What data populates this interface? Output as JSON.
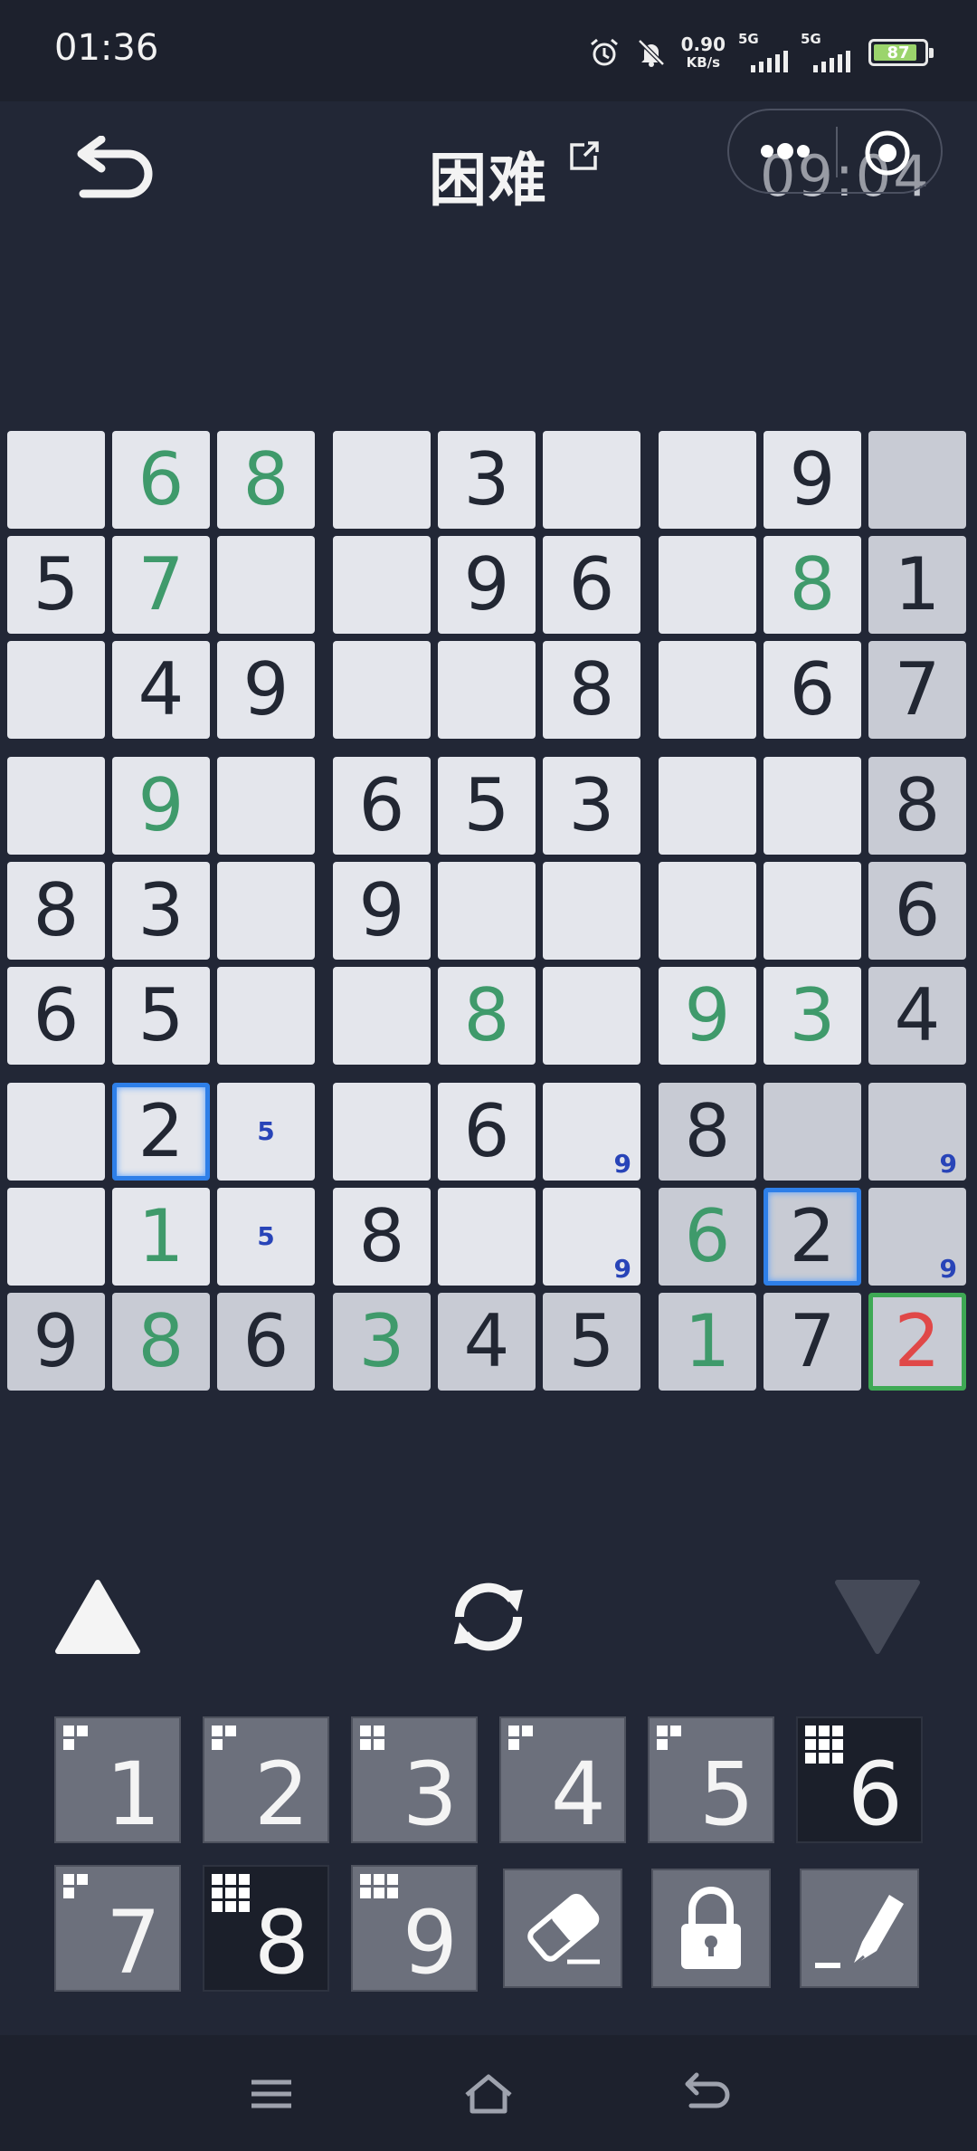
{
  "status_bar": {
    "time": "01:36",
    "net_speed_value": "0.90",
    "net_speed_unit": "KB/s",
    "sim1_label": "5G",
    "sim2_label": "5G",
    "battery_percent": "87",
    "icons": [
      "alarm-icon",
      "bell-muted-icon",
      "signal-icon",
      "battery-icon"
    ]
  },
  "header": {
    "title": "困难",
    "timer": "09:04",
    "icons": [
      "back-arrow-icon",
      "share-external-icon",
      "more-dots-icon",
      "close-target-icon"
    ]
  },
  "board": {
    "cells": [
      {
        "r": 0,
        "c": 0,
        "v": "",
        "t": "empty"
      },
      {
        "r": 0,
        "c": 1,
        "v": "6",
        "t": "user"
      },
      {
        "r": 0,
        "c": 2,
        "v": "8",
        "t": "user"
      },
      {
        "r": 0,
        "c": 3,
        "v": "",
        "t": "empty"
      },
      {
        "r": 0,
        "c": 4,
        "v": "3",
        "t": "given"
      },
      {
        "r": 0,
        "c": 5,
        "v": "",
        "t": "empty"
      },
      {
        "r": 0,
        "c": 6,
        "v": "",
        "t": "empty"
      },
      {
        "r": 0,
        "c": 7,
        "v": "9",
        "t": "given"
      },
      {
        "r": 0,
        "c": 8,
        "v": "",
        "t": "empty",
        "hl": true
      },
      {
        "r": 1,
        "c": 0,
        "v": "5",
        "t": "given"
      },
      {
        "r": 1,
        "c": 1,
        "v": "7",
        "t": "user"
      },
      {
        "r": 1,
        "c": 2,
        "v": "",
        "t": "empty"
      },
      {
        "r": 1,
        "c": 3,
        "v": "",
        "t": "empty"
      },
      {
        "r": 1,
        "c": 4,
        "v": "9",
        "t": "given"
      },
      {
        "r": 1,
        "c": 5,
        "v": "6",
        "t": "given"
      },
      {
        "r": 1,
        "c": 6,
        "v": "",
        "t": "empty"
      },
      {
        "r": 1,
        "c": 7,
        "v": "8",
        "t": "user"
      },
      {
        "r": 1,
        "c": 8,
        "v": "1",
        "t": "given",
        "hl": true
      },
      {
        "r": 2,
        "c": 0,
        "v": "",
        "t": "empty"
      },
      {
        "r": 2,
        "c": 1,
        "v": "4",
        "t": "given"
      },
      {
        "r": 2,
        "c": 2,
        "v": "9",
        "t": "given"
      },
      {
        "r": 2,
        "c": 3,
        "v": "",
        "t": "empty"
      },
      {
        "r": 2,
        "c": 4,
        "v": "",
        "t": "empty"
      },
      {
        "r": 2,
        "c": 5,
        "v": "8",
        "t": "given"
      },
      {
        "r": 2,
        "c": 6,
        "v": "",
        "t": "empty"
      },
      {
        "r": 2,
        "c": 7,
        "v": "6",
        "t": "given"
      },
      {
        "r": 2,
        "c": 8,
        "v": "7",
        "t": "given",
        "hl": true
      },
      {
        "r": 3,
        "c": 0,
        "v": "",
        "t": "empty"
      },
      {
        "r": 3,
        "c": 1,
        "v": "9",
        "t": "user"
      },
      {
        "r": 3,
        "c": 2,
        "v": "",
        "t": "empty"
      },
      {
        "r": 3,
        "c": 3,
        "v": "6",
        "t": "given"
      },
      {
        "r": 3,
        "c": 4,
        "v": "5",
        "t": "given"
      },
      {
        "r": 3,
        "c": 5,
        "v": "3",
        "t": "given"
      },
      {
        "r": 3,
        "c": 6,
        "v": "",
        "t": "empty"
      },
      {
        "r": 3,
        "c": 7,
        "v": "",
        "t": "empty"
      },
      {
        "r": 3,
        "c": 8,
        "v": "8",
        "t": "given",
        "hl": true
      },
      {
        "r": 4,
        "c": 0,
        "v": "8",
        "t": "given"
      },
      {
        "r": 4,
        "c": 1,
        "v": "3",
        "t": "given"
      },
      {
        "r": 4,
        "c": 2,
        "v": "",
        "t": "empty"
      },
      {
        "r": 4,
        "c": 3,
        "v": "9",
        "t": "given"
      },
      {
        "r": 4,
        "c": 4,
        "v": "",
        "t": "empty"
      },
      {
        "r": 4,
        "c": 5,
        "v": "",
        "t": "empty"
      },
      {
        "r": 4,
        "c": 6,
        "v": "",
        "t": "empty"
      },
      {
        "r": 4,
        "c": 7,
        "v": "",
        "t": "empty"
      },
      {
        "r": 4,
        "c": 8,
        "v": "6",
        "t": "given",
        "hl": true
      },
      {
        "r": 5,
        "c": 0,
        "v": "6",
        "t": "given"
      },
      {
        "r": 5,
        "c": 1,
        "v": "5",
        "t": "given"
      },
      {
        "r": 5,
        "c": 2,
        "v": "",
        "t": "empty"
      },
      {
        "r": 5,
        "c": 3,
        "v": "",
        "t": "empty"
      },
      {
        "r": 5,
        "c": 4,
        "v": "8",
        "t": "user"
      },
      {
        "r": 5,
        "c": 5,
        "v": "",
        "t": "empty"
      },
      {
        "r": 5,
        "c": 6,
        "v": "9",
        "t": "user"
      },
      {
        "r": 5,
        "c": 7,
        "v": "3",
        "t": "user"
      },
      {
        "r": 5,
        "c": 8,
        "v": "4",
        "t": "given",
        "hl": true
      },
      {
        "r": 6,
        "c": 0,
        "v": "",
        "t": "empty"
      },
      {
        "r": 6,
        "c": 1,
        "v": "2",
        "t": "given",
        "sel": true
      },
      {
        "r": 6,
        "c": 2,
        "v": "",
        "t": "empty",
        "note": "5",
        "np": "c"
      },
      {
        "r": 6,
        "c": 3,
        "v": "",
        "t": "empty"
      },
      {
        "r": 6,
        "c": 4,
        "v": "6",
        "t": "given"
      },
      {
        "r": 6,
        "c": 5,
        "v": "",
        "t": "empty",
        "note": "9",
        "np": "br"
      },
      {
        "r": 6,
        "c": 6,
        "v": "8",
        "t": "given",
        "hl": true
      },
      {
        "r": 6,
        "c": 7,
        "v": "",
        "t": "empty",
        "hl": true
      },
      {
        "r": 6,
        "c": 8,
        "v": "",
        "t": "empty",
        "hl": true,
        "note": "9",
        "np": "br"
      },
      {
        "r": 7,
        "c": 0,
        "v": "",
        "t": "empty"
      },
      {
        "r": 7,
        "c": 1,
        "v": "1",
        "t": "user"
      },
      {
        "r": 7,
        "c": 2,
        "v": "",
        "t": "empty",
        "note": "5",
        "np": "c"
      },
      {
        "r": 7,
        "c": 3,
        "v": "8",
        "t": "given"
      },
      {
        "r": 7,
        "c": 4,
        "v": "",
        "t": "empty"
      },
      {
        "r": 7,
        "c": 5,
        "v": "",
        "t": "empty",
        "note": "9",
        "np": "br"
      },
      {
        "r": 7,
        "c": 6,
        "v": "6",
        "t": "user",
        "hl": true
      },
      {
        "r": 7,
        "c": 7,
        "v": "2",
        "t": "given",
        "hl": true,
        "sel": true
      },
      {
        "r": 7,
        "c": 8,
        "v": "",
        "t": "empty",
        "hl": true,
        "note": "9",
        "np": "br"
      },
      {
        "r": 8,
        "c": 0,
        "v": "9",
        "t": "given",
        "hl": true
      },
      {
        "r": 8,
        "c": 1,
        "v": "8",
        "t": "user",
        "hl": true
      },
      {
        "r": 8,
        "c": 2,
        "v": "6",
        "t": "given",
        "hl": true
      },
      {
        "r": 8,
        "c": 3,
        "v": "3",
        "t": "user",
        "hl": true
      },
      {
        "r": 8,
        "c": 4,
        "v": "4",
        "t": "given",
        "hl": true
      },
      {
        "r": 8,
        "c": 5,
        "v": "5",
        "t": "given",
        "hl": true
      },
      {
        "r": 8,
        "c": 6,
        "v": "1",
        "t": "user",
        "hl": true
      },
      {
        "r": 8,
        "c": 7,
        "v": "7",
        "t": "given",
        "hl": true
      },
      {
        "r": 8,
        "c": 8,
        "v": "2",
        "t": "error",
        "hl": true
      }
    ]
  },
  "controls": {
    "icons": [
      "triangle-up-icon",
      "refresh-icon",
      "triangle-down-icon"
    ]
  },
  "keypad": {
    "keys": [
      {
        "label": "1",
        "done": false,
        "filled": [
          0,
          1,
          3
        ]
      },
      {
        "label": "2",
        "done": false,
        "filled": [
          0,
          1,
          3
        ]
      },
      {
        "label": "3",
        "done": false,
        "filled": [
          0,
          1,
          3,
          4
        ]
      },
      {
        "label": "4",
        "done": false,
        "filled": [
          0,
          1,
          3
        ]
      },
      {
        "label": "5",
        "done": false,
        "filled": [
          0,
          1,
          3
        ]
      },
      {
        "label": "6",
        "done": true,
        "filled": [
          0,
          1,
          2,
          3,
          4,
          5,
          6,
          7,
          8
        ]
      },
      {
        "label": "7",
        "done": false,
        "filled": [
          0,
          1,
          3
        ]
      },
      {
        "label": "8",
        "done": true,
        "filled": [
          0,
          1,
          2,
          3,
          4,
          5,
          6,
          7,
          8
        ]
      },
      {
        "label": "9",
        "done": false,
        "filled": [
          0,
          1,
          2,
          3,
          4,
          5
        ]
      }
    ],
    "tools": [
      "eraser-icon",
      "lock-icon",
      "pencil-icon"
    ]
  },
  "nav_bar": {
    "icons": [
      "menu-icon",
      "home-icon",
      "back-icon"
    ]
  },
  "colors": {
    "background": "#222736",
    "cell_light": "#e4e6ec",
    "cell_highlight": "#c8cbd4",
    "user_digit": "#3f9a6b",
    "error_digit": "#e04848",
    "note": "#2844b8",
    "selection": "#2e7fe8"
  }
}
